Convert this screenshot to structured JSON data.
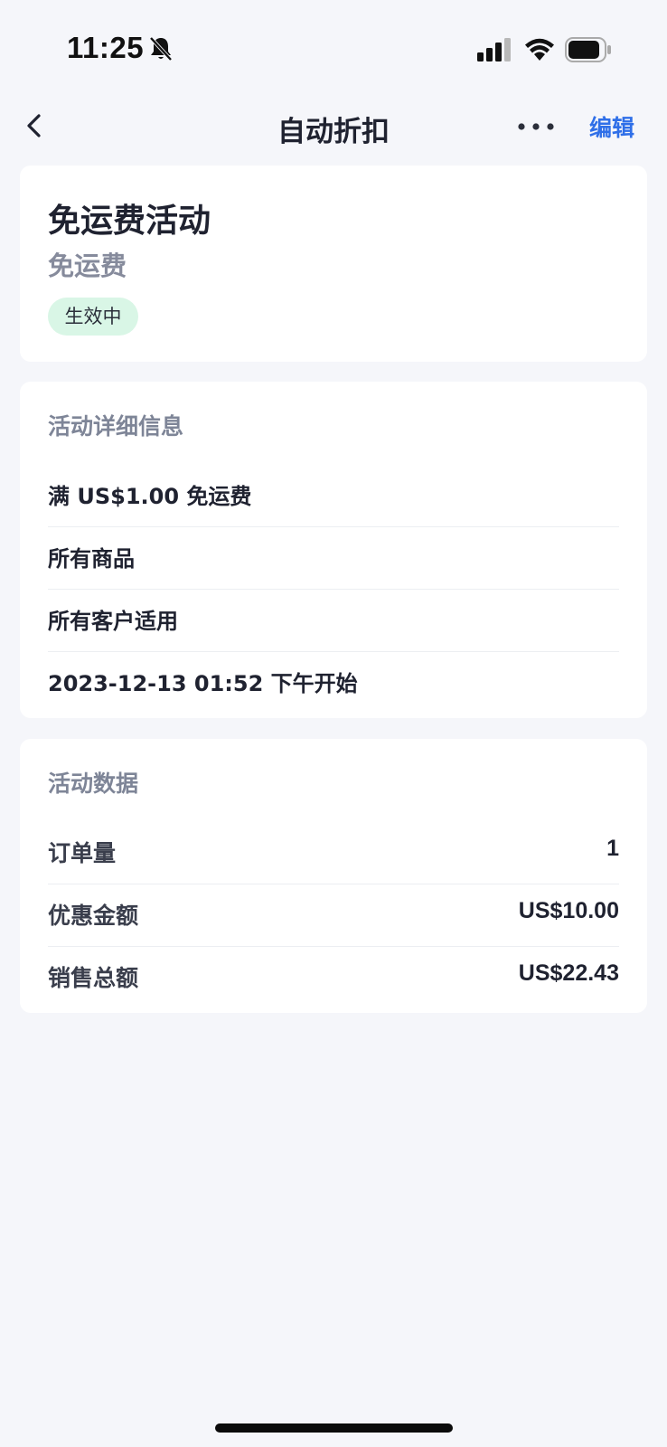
{
  "status_bar": {
    "time": "11:25",
    "icons": [
      "bell-slash-icon",
      "signal-icon",
      "wifi-icon",
      "battery-icon"
    ]
  },
  "nav": {
    "title": "自动折扣",
    "edit_label": "编辑",
    "icons": [
      "back-icon",
      "more-icon"
    ]
  },
  "activity": {
    "title": "免运费活动",
    "subtitle": "免运费",
    "status": "生效中"
  },
  "details": {
    "heading": "活动详细信息",
    "rows": [
      "满 US$1.00 免运费",
      "所有商品",
      "所有客户适用",
      "2023-12-13 01:52 下午开始"
    ]
  },
  "stats": {
    "heading": "活动数据",
    "rows": [
      {
        "label": "订单量",
        "value": "1"
      },
      {
        "label": "优惠金额",
        "value": "US$10.00"
      },
      {
        "label": "销售总额",
        "value": "US$22.43"
      }
    ]
  },
  "colors": {
    "background": "#f5f6fa",
    "accent": "#2f6fe8",
    "badge_bg": "#d9f6e6",
    "muted_text": "#868b9c"
  }
}
